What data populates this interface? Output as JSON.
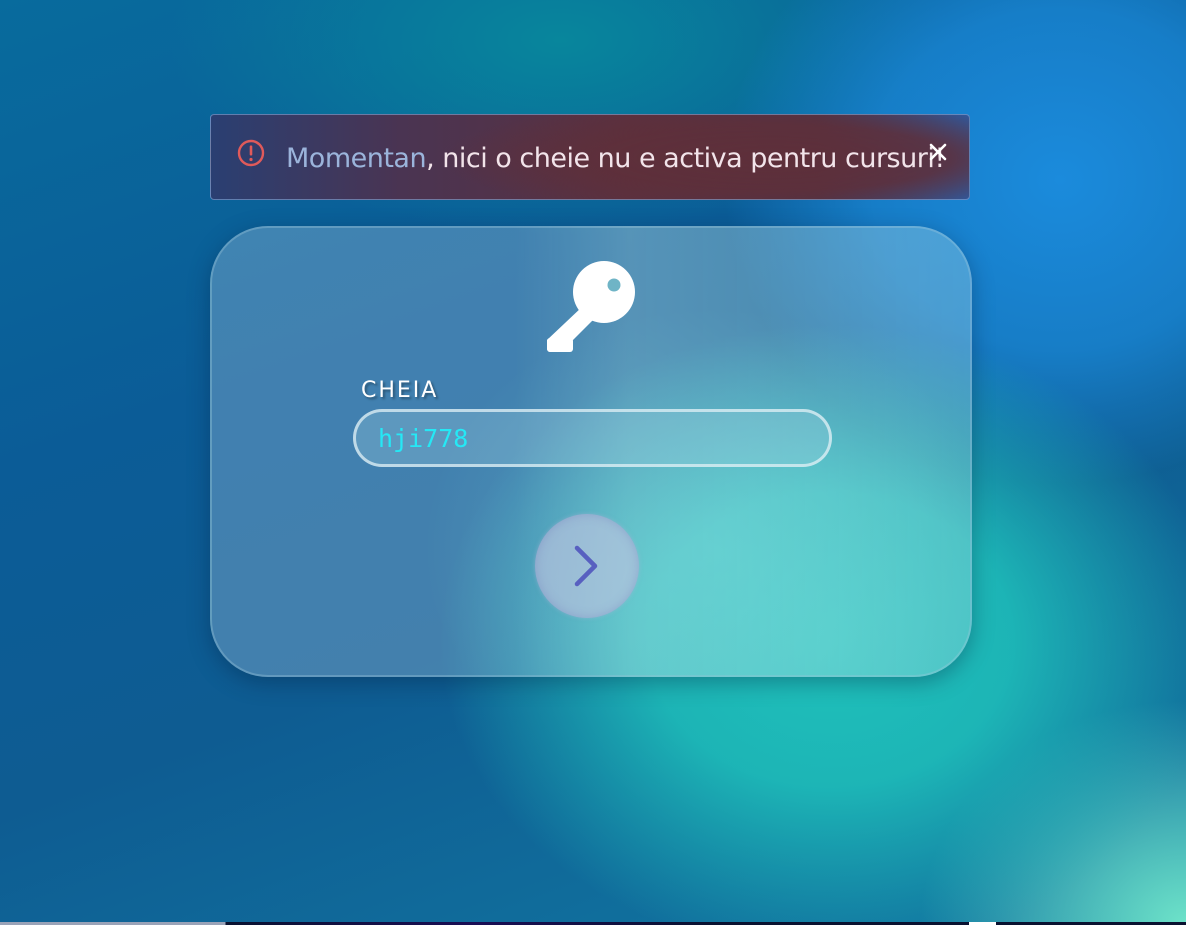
{
  "alert": {
    "message_lead": "Momentan",
    "message_rest": ", nici o cheie nu e activa pentru cursuri!",
    "icon": "exclamation-circle-icon",
    "close_icon": "close-icon",
    "accent_color": "#e05a5a"
  },
  "card": {
    "icon": "key-icon",
    "field_label": "CHEIA",
    "input_value": "hji778",
    "submit_icon": "chevron-right-icon"
  },
  "colors": {
    "input_text": "#25e8f5",
    "chevron": "#5860c0"
  }
}
